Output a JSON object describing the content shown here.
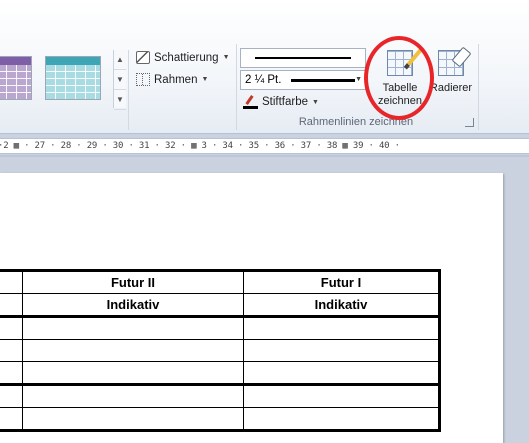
{
  "ribbon": {
    "shading": {
      "label": "Schattierung"
    },
    "borders": {
      "label": "Rahmen"
    },
    "pen_weight": {
      "value": "2 ¼ Pt."
    },
    "pen_color": {
      "label": "Stiftfarbe"
    },
    "draw_table": {
      "line1": "Tabelle",
      "line2": "zeichnen"
    },
    "eraser": {
      "label": "Radierer"
    },
    "group_label": "Rahmenlinien zeichnen",
    "highlight_color": "#e8262a"
  },
  "ruler": {
    "text": "·2 ▦ · 27 · 28 · 29 · 30 · 31 · 32 · ▦ 3 · 34 · 35 · 36 · 37 · 38 ▦ 39 · 40 ·"
  },
  "table": {
    "header_row1": [
      "",
      "Futur II",
      "Futur I"
    ],
    "header_row2": [
      "",
      "Indikativ",
      "Indikativ"
    ]
  }
}
